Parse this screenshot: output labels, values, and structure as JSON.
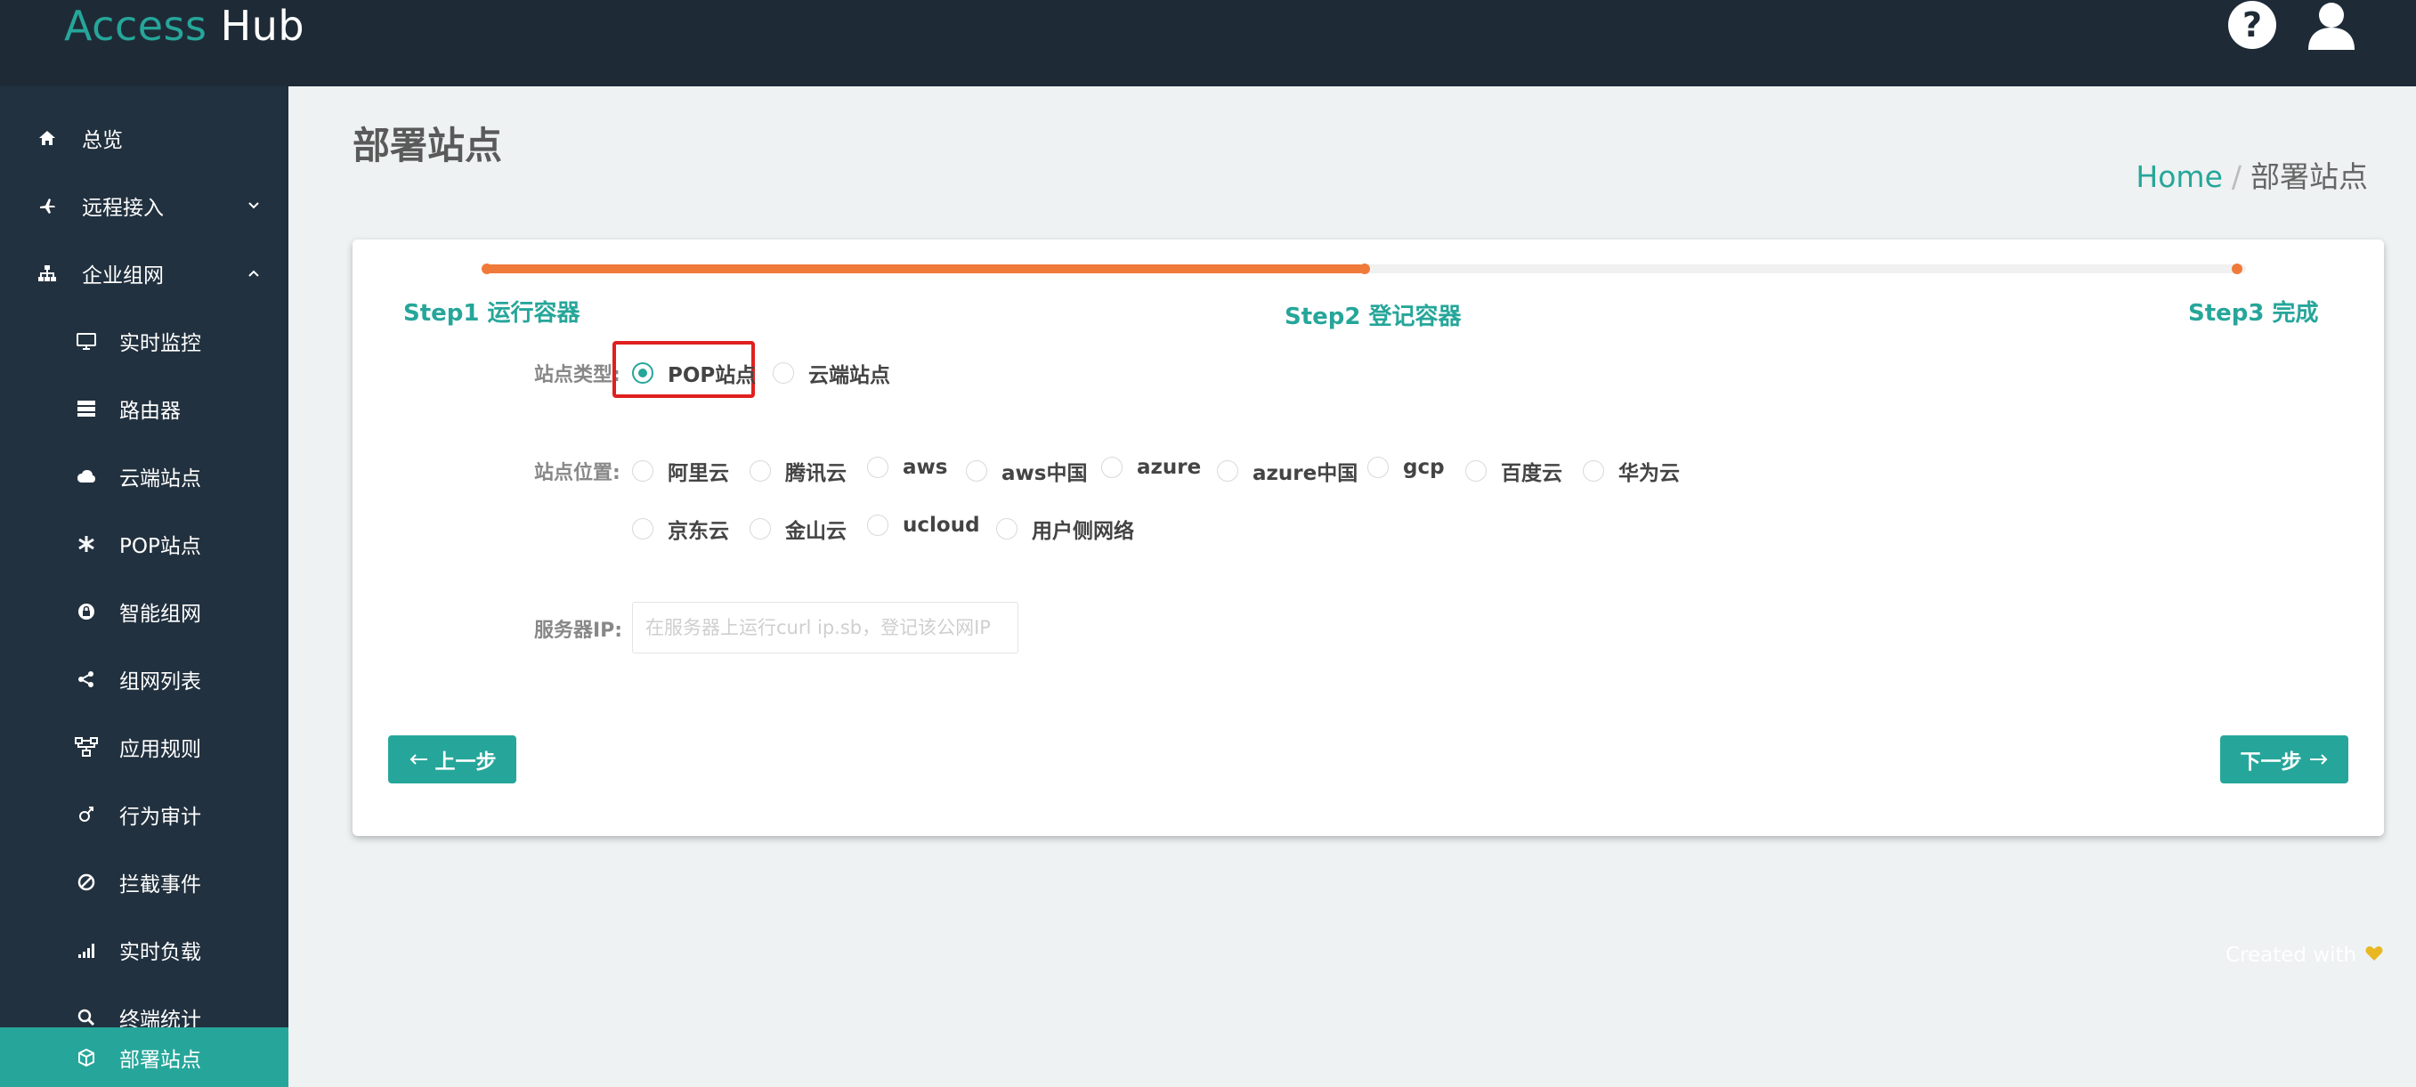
{
  "app": {
    "logo_part1": "Access",
    "logo_part2": "Hub"
  },
  "header": {
    "help_icon": "question-circle-icon",
    "user_icon": "user-icon"
  },
  "sidebar": {
    "items": [
      {
        "label": "总览",
        "icon": "home-icon"
      },
      {
        "label": "远程接入",
        "icon": "plane-icon",
        "chevron": "down"
      },
      {
        "label": "企业组网",
        "icon": "sitemap-icon",
        "chevron": "up"
      },
      {
        "label": "实时监控",
        "icon": "monitor-icon"
      },
      {
        "label": "路由器",
        "icon": "server-icon"
      },
      {
        "label": "云端站点",
        "icon": "cloud-icon"
      },
      {
        "label": "POP站点",
        "icon": "asterisk-icon"
      },
      {
        "label": "智能组网",
        "icon": "lock-circle-icon"
      },
      {
        "label": "组网列表",
        "icon": "share-icon"
      },
      {
        "label": "应用规则",
        "icon": "network-icon"
      },
      {
        "label": "行为审计",
        "icon": "venus-mars-icon"
      },
      {
        "label": "拦截事件",
        "icon": "ban-icon"
      },
      {
        "label": "实时负载",
        "icon": "signal-icon"
      },
      {
        "label": "终端统计",
        "icon": "search-icon"
      },
      {
        "label": "部署站点",
        "icon": "cube-icon",
        "active": true
      }
    ]
  },
  "page": {
    "title": "部署站点",
    "breadcrumb_home": "Home",
    "breadcrumb_sep": "/",
    "breadcrumb_current": "部署站点"
  },
  "wizard": {
    "progress_percent": 50,
    "steps": [
      "Step1 运行容器",
      "Step2 登记容器",
      "Step3 完成"
    ],
    "colors": {
      "accent": "#26a69a",
      "progress": "#f07a3a",
      "highlight": "#e0201e"
    }
  },
  "form": {
    "site_type_label": "站点类型:",
    "site_types": [
      {
        "label": "POP站点",
        "checked": true
      },
      {
        "label": "云端站点",
        "checked": false
      }
    ],
    "location_label": "站点位置:",
    "locations_row1": [
      "阿里云",
      "腾讯云",
      "aws",
      "aws中国",
      "azure",
      "azure中国",
      "gcp",
      "百度云",
      "华为云"
    ],
    "locations_row2": [
      "京东云",
      "金山云",
      "ucloud",
      "用户侧网络"
    ],
    "server_ip_label": "服务器IP:",
    "server_ip_placeholder": "在服务器上运行curl ip.sb，登记该公网IP",
    "server_ip_value": ""
  },
  "buttons": {
    "prev": "上一步",
    "next": "下一步"
  },
  "footer": {
    "text": "Created with",
    "icon": "heart-icon"
  }
}
